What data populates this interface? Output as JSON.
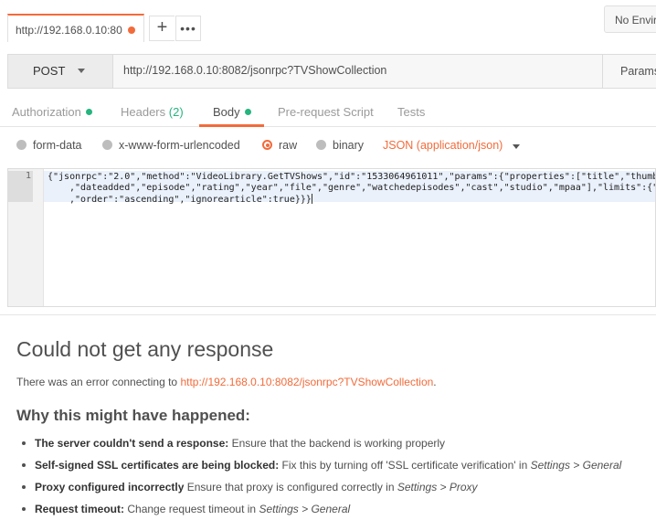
{
  "tabs": {
    "active_tab_label": "http://192.168.0.10:80",
    "add_icon": "plus-icon",
    "more_icon": "ellipsis-icon"
  },
  "environment": {
    "label": "No Envir"
  },
  "request": {
    "method": "POST",
    "url": "http://192.168.0.10:8082/jsonrpc?TVShowCollection",
    "params_label": "Params"
  },
  "request_tabs": [
    {
      "label": "Authorization",
      "dot": true
    },
    {
      "label": "Headers",
      "count": "(2)"
    },
    {
      "label": "Body",
      "dot": true,
      "active": true
    },
    {
      "label": "Pre-request Script"
    },
    {
      "label": "Tests"
    }
  ],
  "body_options": {
    "form_data": "form-data",
    "urlencoded": "x-www-form-urlencoded",
    "raw": "raw",
    "binary": "binary",
    "selected": "raw",
    "content_type": "JSON (application/json)"
  },
  "editor": {
    "line_number": "1",
    "lines": [
      "{\"jsonrpc\":\"2.0\",\"method\":\"VideoLibrary.GetTVShows\",\"id\":\"1533064961011\",\"params\":{\"properties\":[\"title\",\"thumb",
      ",\"dateadded\",\"episode\",\"rating\",\"year\",\"file\",\"genre\",\"watchedepisodes\",\"cast\",\"studio\",\"mpaa\"],\"limits\":{\"",
      ",\"order\":\"ascending\",\"ignorearticle\":true}}}"
    ]
  },
  "response": {
    "title": "Could not get any response",
    "message_prefix": "There was an error connecting to ",
    "message_link": "http://192.168.0.10:8082/jsonrpc?TVShowCollection",
    "message_suffix": ".",
    "why_heading": "Why this might have happened:",
    "reasons": [
      {
        "bold": "The server couldn't send a response:",
        "text": " Ensure that the backend is working properly"
      },
      {
        "bold": "Self-signed SSL certificates are being blocked:",
        "text": " Fix this by turning off 'SSL certificate verification' in ",
        "italic": "Settings > General"
      },
      {
        "bold": "Proxy configured incorrectly",
        "text": " Ensure that proxy is configured correctly in ",
        "italic": "Settings > Proxy"
      },
      {
        "bold": "Request timeout:",
        "text": " Change request timeout in ",
        "italic": "Settings > General"
      }
    ]
  },
  "colors": {
    "accent": "#f26b3a",
    "success": "#26b47f",
    "text": "#505050"
  }
}
